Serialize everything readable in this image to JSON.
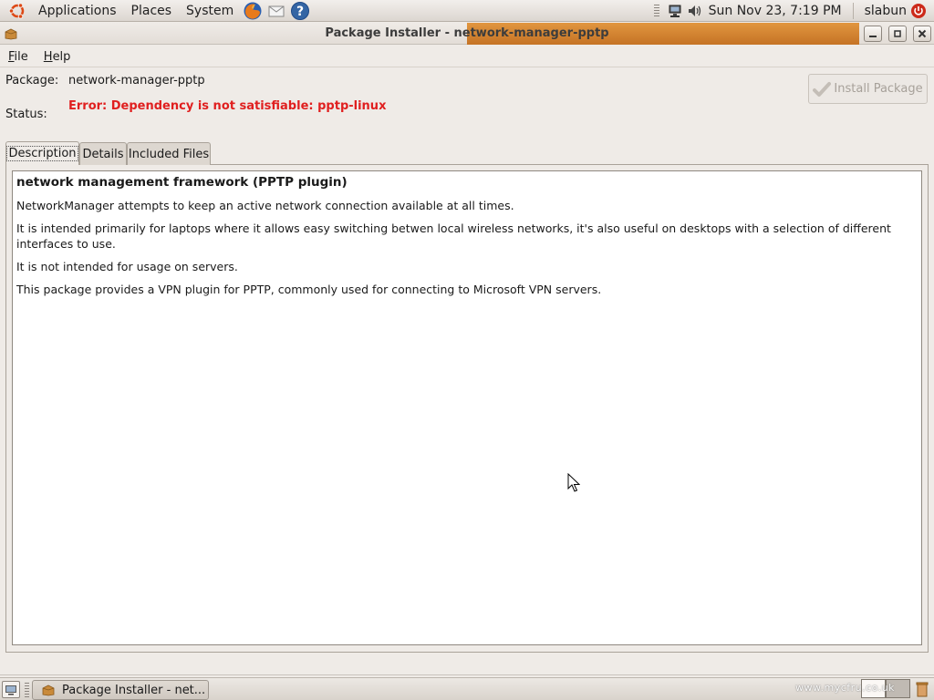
{
  "top_panel": {
    "menus": [
      "Applications",
      "Places",
      "System"
    ],
    "clock": "Sun Nov 23,  7:19 PM",
    "user": "slabun"
  },
  "window": {
    "title": "Package Installer - network-manager-pptp"
  },
  "menubar": {
    "file_label": "File",
    "file_mnemonic": "F",
    "file_rest": "ile",
    "help_label": "Help",
    "help_mnemonic": "H",
    "help_rest": "elp"
  },
  "package_info": {
    "package_label": "Package:",
    "package_value": "network-manager-pptp",
    "status_label": "Status:",
    "status_value": "Error: Dependency is not satisfiable: pptp-linux",
    "status_color": "#e01f1f"
  },
  "install_button": {
    "label": "Install Package",
    "enabled": false
  },
  "tabs": [
    {
      "label": "Description",
      "active": true
    },
    {
      "label": "Details",
      "active": false
    },
    {
      "label": "Included Files",
      "active": false
    }
  ],
  "description": {
    "title": "network management framework (PPTP plugin)",
    "paragraphs": [
      "NetworkManager attempts to keep an active network connection available at all times.",
      "It is intended primarily for laptops where it allows easy switching betwen local wireless networks, it's also useful on desktops with a selection of different interfaces to use.",
      "It is not intended for usage on servers.",
      "This package provides a VPN plugin for PPTP, commonly used for connecting to Microsoft VPN servers."
    ]
  },
  "taskbar": {
    "task_label": "Package Installer - net..."
  },
  "watermark": "www.mycfru.co.uk",
  "colors": {
    "accent_orange": "#d98a36",
    "panel_bg": "#efebe7",
    "error_red": "#e01f1f"
  },
  "icons": [
    "ubuntu-logo-icon",
    "firefox-icon",
    "mail-icon",
    "help-icon",
    "network-icon",
    "volume-icon",
    "power-icon",
    "package-icon",
    "checkmark-icon",
    "show-desktop-icon"
  ]
}
